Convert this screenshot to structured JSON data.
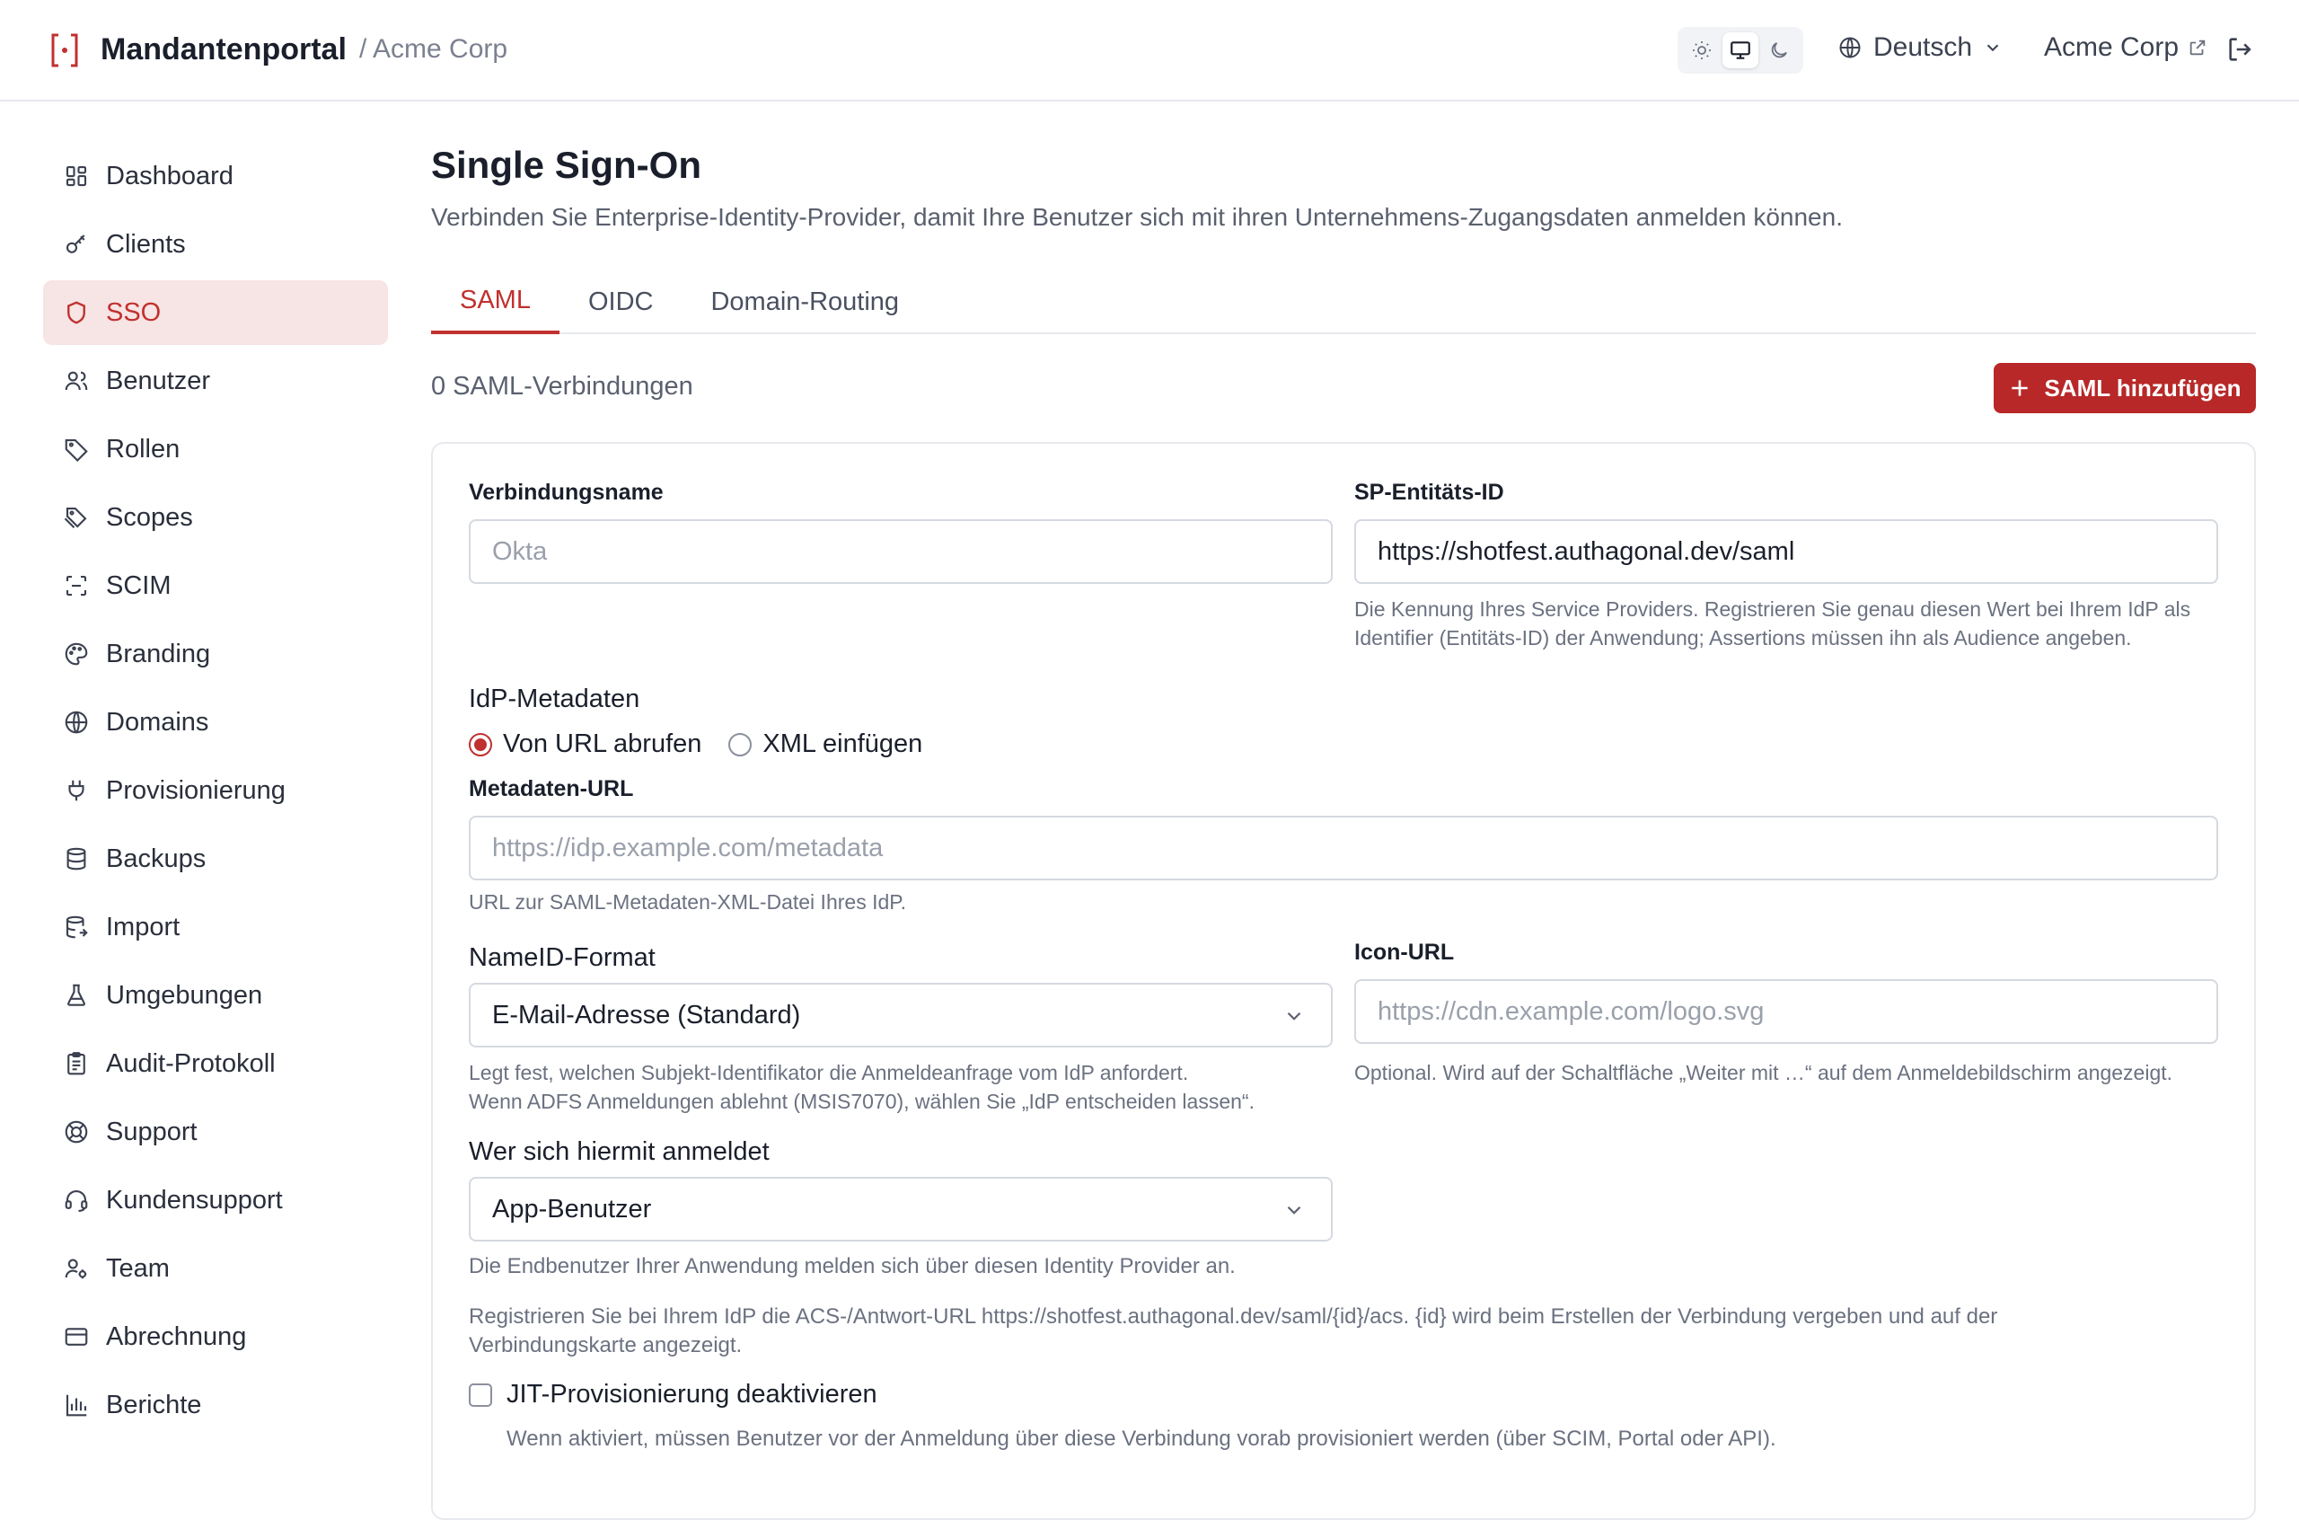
{
  "header": {
    "app_title": "Mandantenportal",
    "breadcrumb": "/ Acme Corp",
    "language": "Deutsch",
    "tenant": "Acme Corp",
    "theme_options": [
      "sun-icon",
      "monitor-icon",
      "moon-icon"
    ],
    "theme_active": "monitor"
  },
  "sidebar": {
    "items": [
      {
        "label": "Dashboard",
        "icon": "dashboard-icon"
      },
      {
        "label": "Clients",
        "icon": "key-icon"
      },
      {
        "label": "SSO",
        "icon": "shield-icon",
        "active": true
      },
      {
        "label": "Benutzer",
        "icon": "users-icon"
      },
      {
        "label": "Rollen",
        "icon": "tag-icon"
      },
      {
        "label": "Scopes",
        "icon": "tags-icon"
      },
      {
        "label": "SCIM",
        "icon": "scan-icon"
      },
      {
        "label": "Branding",
        "icon": "palette-icon"
      },
      {
        "label": "Domains",
        "icon": "globe-icon"
      },
      {
        "label": "Provisionierung",
        "icon": "plug-icon"
      },
      {
        "label": "Backups",
        "icon": "database-icon"
      },
      {
        "label": "Import",
        "icon": "database-import-icon"
      },
      {
        "label": "Umgebungen",
        "icon": "flask-icon"
      },
      {
        "label": "Audit-Protokoll",
        "icon": "clipboard-icon"
      },
      {
        "label": "Support",
        "icon": "lifebuoy-icon"
      },
      {
        "label": "Kundensupport",
        "icon": "headset-icon"
      },
      {
        "label": "Team",
        "icon": "team-icon"
      },
      {
        "label": "Abrechnung",
        "icon": "credit-card-icon"
      },
      {
        "label": "Berichte",
        "icon": "bar-chart-icon"
      }
    ]
  },
  "main": {
    "title": "Single Sign-On",
    "subtitle": "Verbinden Sie Enterprise-Identity-Provider, damit Ihre Benutzer sich mit ihren Unternehmens-Zugangsdaten anmelden können.",
    "tabs": [
      {
        "label": "SAML",
        "active": true
      },
      {
        "label": "OIDC"
      },
      {
        "label": "Domain-Routing"
      }
    ],
    "connection_count": "0 SAML-Verbindungen",
    "add_button": "SAML hinzufügen",
    "form": {
      "connection_name_label": "Verbindungsname",
      "connection_name_placeholder": "Okta",
      "sp_entity_label": "SP-Entitäts-ID",
      "sp_entity_value": "https://shotfest.authagonal.dev/saml",
      "sp_entity_help_1": "Die Kennung Ihres Service Providers. Registrieren Sie genau diesen Wert bei Ihrem IdP als",
      "sp_entity_help_2": "Identifier (Entitäts-ID) der Anwendung; Assertions müssen ihn als Audience angeben.",
      "idp_metadata_label": "IdP-Metadaten",
      "radio_url": "Von URL abrufen",
      "radio_xml": "XML einfügen",
      "radio_selected": "url",
      "metadata_url_label": "Metadaten-URL",
      "metadata_url_placeholder": "https://idp.example.com/metadata",
      "metadata_url_help": "URL zur SAML-Metadaten-XML-Datei Ihres IdP.",
      "nameid_label": "NameID-Format",
      "nameid_value": "E-Mail-Adresse (Standard)",
      "nameid_help_1": "Legt fest, welchen Subjekt-Identifikator die Anmeldeanfrage vom IdP anfordert.",
      "nameid_help_2": "Wenn ADFS Anmeldungen ablehnt (MSIS7070), wählen Sie „IdP entscheiden lassen“.",
      "icon_url_label": "Icon-URL",
      "icon_url_placeholder": "https://cdn.example.com/logo.svg",
      "icon_url_help": "Optional. Wird auf der Schaltfläche „Weiter mit …“ auf dem Anmeldebildschirm angezeigt.",
      "who_label": "Wer sich hiermit anmeldet",
      "who_value": "App-Benutzer",
      "who_help": "Die Endbenutzer Ihrer Anwendung melden sich über diesen Identity Provider an.",
      "acs_help_1": "Registrieren Sie bei Ihrem IdP die ACS-/Antwort-URL https://shotfest.authagonal.dev/saml/{id}/acs. {id} wird beim Erstellen der Verbindung vergeben und auf der",
      "acs_help_2": "Verbindungskarte angezeigt.",
      "jit_label": "JIT-Provisionierung deaktivieren",
      "jit_help": "Wenn aktiviert, müssen Benutzer vor der Anmeldung über diese Verbindung vorab provisioniert werden (über SCIM, Portal oder API)."
    }
  },
  "colors": {
    "accent": "#c0312f",
    "button": "#b82828",
    "active_bg": "#f7e4e4"
  }
}
